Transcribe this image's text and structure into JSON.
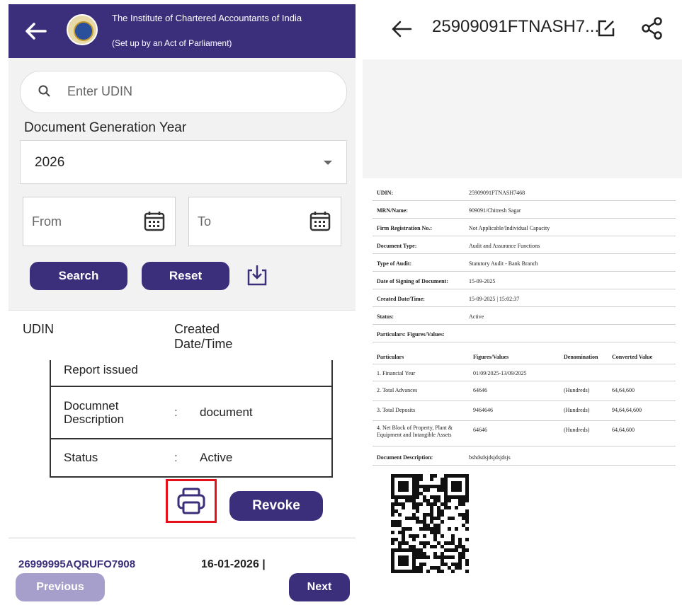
{
  "left_panel": {
    "header": {
      "title": "The Institute of Chartered Accountants of India",
      "subtitle": "(Set up by an Act of Parliament)"
    },
    "search": {
      "placeholder": "Enter UDIN"
    },
    "year_label": "Document Generation Year",
    "year_value": "2026",
    "from_label": "From",
    "to_label": "To",
    "search_button": "Search",
    "reset_button": "Reset",
    "table_header": {
      "udin": "UDIN",
      "created": "Created Date/Time"
    },
    "record": {
      "report_issued": "Report issued",
      "desc_key": "Documnet Description",
      "desc_value": "document",
      "status_key": "Status",
      "status_value": "Active",
      "colon": ":"
    },
    "revoke_button": "Revoke",
    "next_record": {
      "udin": "26999995AQRUFO7908",
      "date": "16-01-2026 |"
    },
    "previous_button": "Previous",
    "next_button": "Next"
  },
  "right_panel": {
    "title": "25909091FTNASH7...",
    "doc": {
      "rows": [
        {
          "k": "UDIN:",
          "v": "25909091FTNASH7468"
        },
        {
          "k": "MRN/Name:",
          "v": "909091/Chitresh Sagar"
        },
        {
          "k": "Firm Registration No.:",
          "v": "Not Applicable/Individual Capacity"
        },
        {
          "k": "Document Type:",
          "v": "Audit and Assurance Functions"
        },
        {
          "k": "Type of Audit:",
          "v": "Statutory Audit - Bank Branch"
        },
        {
          "k": "Date of Signing of Document:",
          "v": "15-09-2025"
        },
        {
          "k": "Created Date/Time:",
          "v": "15-09-2025 | 15:02:37"
        },
        {
          "k": "Status:",
          "v": "Active"
        },
        {
          "k": "Particulars: Figures/Values:",
          "v": ""
        }
      ],
      "particulars_header": [
        "Particulars",
        "Figures/Values",
        "Denomination",
        "Converted Value"
      ],
      "particulars": [
        {
          "p": "1. Financial Year",
          "f": "01/09/2025-13/09/2025",
          "d": "",
          "c": ""
        },
        {
          "p": "2. Total Advances",
          "f": "64646",
          "d": "(Hundreds)",
          "c": "64,64,600"
        },
        {
          "p": "3. Total Deposits",
          "f": "9464646",
          "d": "(Hundreds)",
          "c": "94,64,64,600"
        },
        {
          "p": "4. Net Block of Property, Plant & Equipment and Intangible Assets",
          "f": "64646",
          "d": "(Hundreds)",
          "c": "64,64,600"
        }
      ],
      "description_key": "Document Description:",
      "description_value": "bshdsdsjdsjdsjdsjs"
    }
  }
}
